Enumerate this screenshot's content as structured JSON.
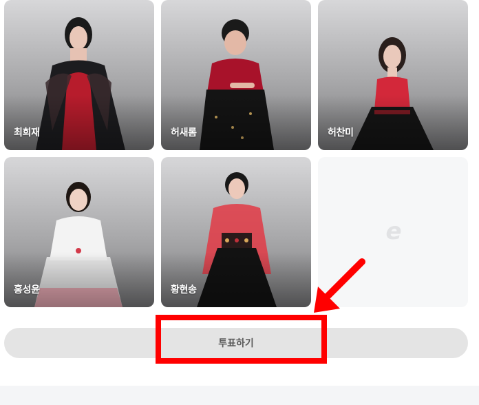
{
  "contestants": [
    {
      "name": "최희재",
      "dress_colors": [
        "#1c1c1f",
        "#b71c2c"
      ]
    },
    {
      "name": "허새롬",
      "dress_colors": [
        "#a8122a",
        "#141414"
      ]
    },
    {
      "name": "허찬미",
      "dress_colors": [
        "#d3283a",
        "#151515"
      ]
    },
    {
      "name": "홍성윤",
      "dress_colors": [
        "#f3f3f3",
        "#e79aa6"
      ]
    },
    {
      "name": "황현송",
      "dress_colors": [
        "#e23a45",
        "#121212"
      ]
    }
  ],
  "placeholder_logo": "e",
  "vote_button": {
    "label": "투표하기"
  },
  "annotation": {
    "color": "#ff0000"
  }
}
